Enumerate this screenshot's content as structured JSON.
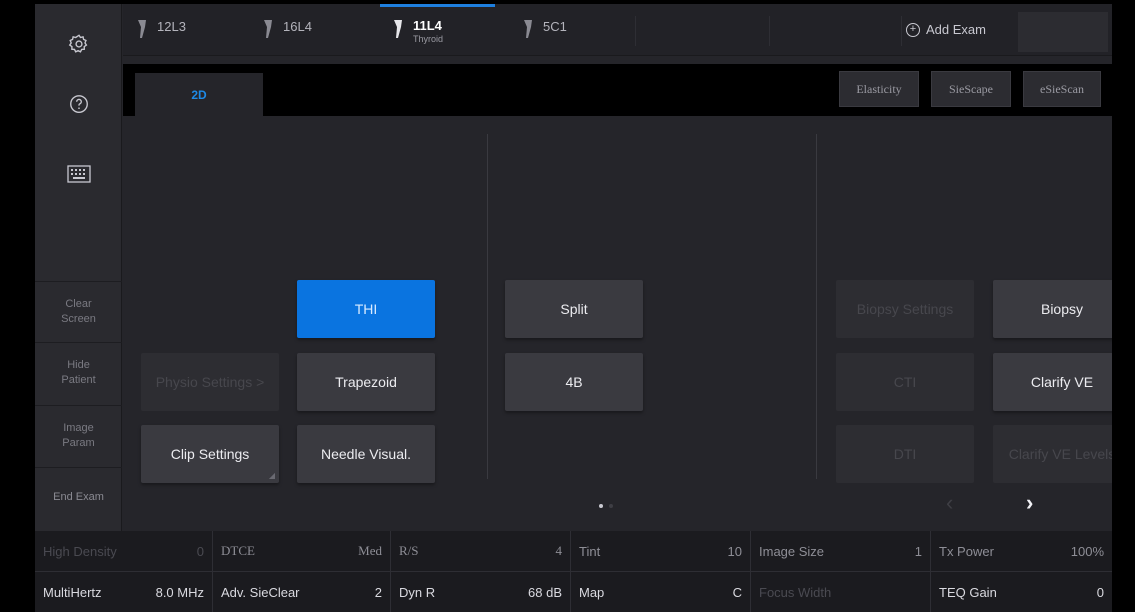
{
  "sidebar": {
    "clear_screen": "Clear\nScreen",
    "hide_patient": "Hide\nPatient",
    "image_param": "Image\nParam",
    "end_exam": "End Exam"
  },
  "probes": [
    {
      "name": "12L3",
      "sub": ""
    },
    {
      "name": "16L4",
      "sub": ""
    },
    {
      "name": "11L4",
      "sub": "Thyroid"
    },
    {
      "name": "5C1",
      "sub": ""
    }
  ],
  "add_exam": "Add Exam",
  "mode_tab": "2D",
  "mode_buttons": [
    "Elasticity",
    "SieScape",
    "eSieScan"
  ],
  "buttons": {
    "physio_settings": "Physio Settings >",
    "clip_settings": "Clip Settings",
    "thi": "THI",
    "trapezoid": "Trapezoid",
    "needle_visual": "Needle Visual.",
    "split": "Split",
    "four_b": "4B",
    "biopsy_settings": "Biopsy Settings",
    "cti": "CTI",
    "dti": "DTI",
    "biopsy": "Biopsy",
    "clarify_ve": "Clarify VE",
    "clarify_ve_levels": "Clarify VE Levels"
  },
  "status_row1": [
    {
      "label": "High Density",
      "value": "0"
    },
    {
      "label": "DTCE",
      "value": "Med"
    },
    {
      "label": "R/S",
      "value": "4"
    },
    {
      "label": "Tint",
      "value": "10"
    },
    {
      "label": "Image Size",
      "value": "1"
    },
    {
      "label": "Tx Power",
      "value": "100%"
    }
  ],
  "status_row2": [
    {
      "label": "MultiHertz",
      "value": "8.0 MHz"
    },
    {
      "label": "Adv. SieClear",
      "value": "2"
    },
    {
      "label": "Dyn R",
      "value": "68 dB"
    },
    {
      "label": "Map",
      "value": "C"
    },
    {
      "label": "Focus Width",
      "value": ""
    },
    {
      "label": "TEQ Gain",
      "value": "0"
    }
  ],
  "colors": {
    "accent": "#0a74e0",
    "tab_indicator": "#1e7fdf",
    "background": "#25252a"
  }
}
